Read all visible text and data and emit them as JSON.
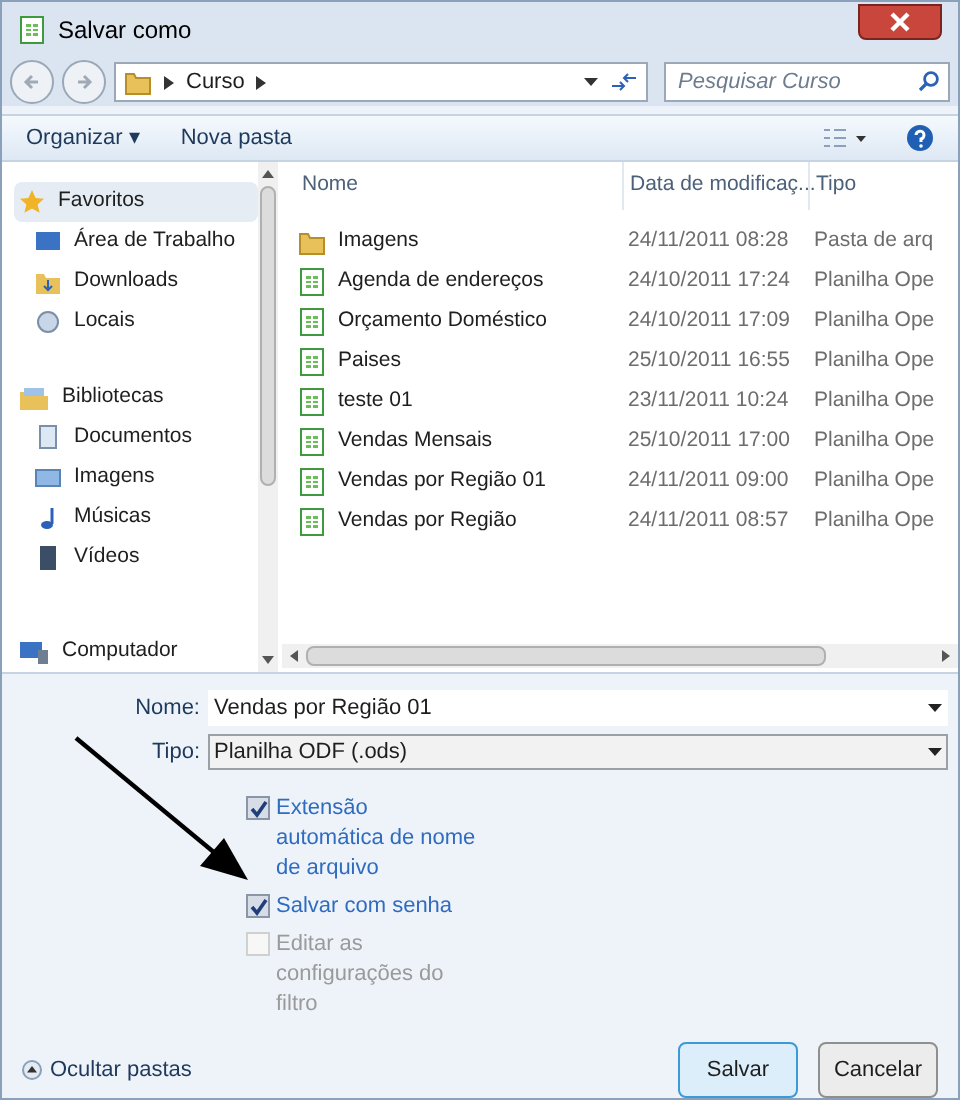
{
  "window": {
    "title": "Salvar como"
  },
  "address": {
    "path": [
      "Curso"
    ],
    "search_placeholder": "Pesquisar Curso"
  },
  "toolbar": {
    "organize": "Organizar ▾",
    "new_folder": "Nova pasta"
  },
  "sidebar": {
    "items": [
      {
        "label": "Favoritos",
        "kind": "star",
        "selected": true,
        "children": [
          {
            "label": "Área de Trabalho",
            "kind": "desktop",
            "selected": false
          },
          {
            "label": "Downloads",
            "kind": "downloads",
            "selected": false
          },
          {
            "label": "Locais",
            "kind": "places",
            "selected": false
          }
        ]
      },
      {
        "label": "Bibliotecas",
        "kind": "library",
        "selected": false,
        "children": [
          {
            "label": "Documentos",
            "kind": "documents",
            "selected": false
          },
          {
            "label": "Imagens",
            "kind": "pictures",
            "selected": false
          },
          {
            "label": "Músicas",
            "kind": "music",
            "selected": false
          },
          {
            "label": "Vídeos",
            "kind": "videos",
            "selected": false
          }
        ]
      },
      {
        "label": "Computador",
        "kind": "computer",
        "selected": false
      }
    ]
  },
  "table": {
    "columns": [
      "Nome",
      "Data de modificaç...",
      "Tipo"
    ],
    "rows": [
      {
        "kind": "folder",
        "name": "Imagens",
        "date": "24/11/2011 08:28",
        "type": "Pasta de arq"
      },
      {
        "kind": "sheet",
        "name": "Agenda de endereços",
        "date": "24/10/2011 17:24",
        "type": "Planilha Ope"
      },
      {
        "kind": "sheet",
        "name": "Orçamento Doméstico",
        "date": "24/10/2011 17:09",
        "type": "Planilha Ope"
      },
      {
        "kind": "sheet",
        "name": "Paises",
        "date": "25/10/2011 16:55",
        "type": "Planilha Ope"
      },
      {
        "kind": "sheet",
        "name": "teste 01",
        "date": "23/11/2011 10:24",
        "type": "Planilha Ope"
      },
      {
        "kind": "sheet",
        "name": "Vendas Mensais",
        "date": "25/10/2011 17:00",
        "type": "Planilha Ope"
      },
      {
        "kind": "sheet",
        "name": "Vendas por Região 01",
        "date": "24/11/2011 09:00",
        "type": "Planilha Ope"
      },
      {
        "kind": "sheet",
        "name": "Vendas por Região",
        "date": "24/11/2011 08:57",
        "type": "Planilha Ope"
      }
    ]
  },
  "form": {
    "name_label": "Nome:",
    "name_value": "Vendas por Região 01",
    "type_label": "Tipo:",
    "type_value": "Planilha ODF (.ods)"
  },
  "options": [
    {
      "label": "Extensão automática de nome de arquivo",
      "checked": true,
      "disabled": false
    },
    {
      "label": "Salvar com senha",
      "checked": true,
      "disabled": false
    },
    {
      "label": "Editar as configurações do filtro",
      "checked": false,
      "disabled": true
    }
  ],
  "footer": {
    "hide_folders": "Ocultar pastas",
    "buttons": [
      "Salvar",
      "Cancelar"
    ]
  }
}
